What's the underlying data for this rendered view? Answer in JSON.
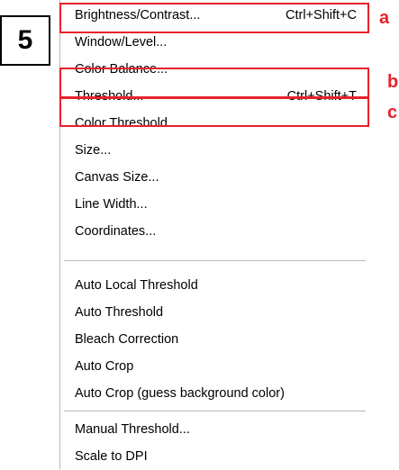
{
  "step_label": "5",
  "callouts": {
    "a": "a",
    "b": "b",
    "c": "c"
  },
  "highlight_color": "#e8212b",
  "menu": {
    "group1": [
      {
        "label": "Brightness/Contrast...",
        "shortcut": "Ctrl+Shift+C",
        "highlighted": true,
        "callout": "a"
      },
      {
        "label": "Window/Level...",
        "shortcut": ""
      },
      {
        "label": "Color Balance...",
        "shortcut": ""
      },
      {
        "label": "Threshold...",
        "shortcut": "Ctrl+Shift+T",
        "highlighted": true,
        "callout": "b"
      },
      {
        "label": "Color Threshold...",
        "shortcut": "",
        "highlighted": true,
        "callout": "c"
      },
      {
        "label": "Size...",
        "shortcut": ""
      },
      {
        "label": "Canvas Size...",
        "shortcut": ""
      },
      {
        "label": "Line Width...",
        "shortcut": ""
      },
      {
        "label": "Coordinates...",
        "shortcut": ""
      }
    ],
    "group2": [
      {
        "label": "Auto Local Threshold"
      },
      {
        "label": "Auto Threshold"
      },
      {
        "label": "Bleach Correction"
      },
      {
        "label": "Auto Crop"
      },
      {
        "label": "Auto Crop (guess background color)"
      }
    ],
    "group3": [
      {
        "label": "Manual Threshold..."
      },
      {
        "label": "Scale to DPI"
      }
    ]
  }
}
